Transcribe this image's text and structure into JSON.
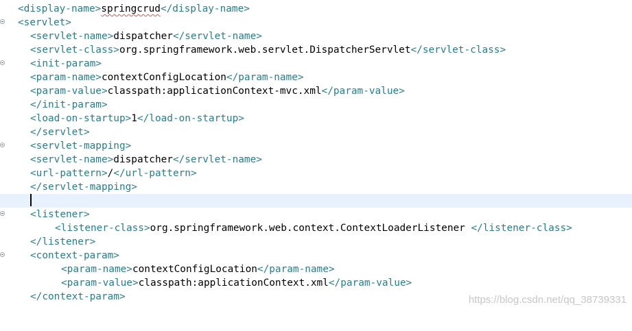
{
  "editor": {
    "lines": [
      {
        "open": "<display-name>",
        "text": "springcrud",
        "close": "</display-name>",
        "fold": false
      },
      {
        "open": "<servlet>",
        "text": "",
        "close": "",
        "fold": true
      },
      {
        "open": "<servlet-name>",
        "text": "dispatcher",
        "close": "</servlet-name>",
        "fold": false
      },
      {
        "open": "<servlet-class>",
        "text": "org.springframework.web.servlet.DispatcherServlet",
        "close": "</servlet-class>",
        "fold": false
      },
      {
        "open": "<init-param>",
        "text": "",
        "close": "",
        "fold": true
      },
      {
        "open": "<param-name>",
        "text": "contextConfigLocation",
        "close": "</param-name>",
        "fold": false
      },
      {
        "open": "<param-value>",
        "text": "classpath:applicationContext-mvc.xml",
        "close": "</param-value>",
        "fold": false
      },
      {
        "open": "</init-param>",
        "text": "",
        "close": "",
        "fold": false
      },
      {
        "open": "<load-on-startup>",
        "text": "1",
        "close": "</load-on-startup>",
        "fold": false
      },
      {
        "open": "</servlet>",
        "text": "",
        "close": "",
        "fold": false
      },
      {
        "open": "<servlet-mapping>",
        "text": "",
        "close": "",
        "fold": true
      },
      {
        "open": "<servlet-name>",
        "text": "dispatcher",
        "close": "</servlet-name>",
        "fold": false
      },
      {
        "open": "<url-pattern>",
        "text": "/",
        "close": "</url-pattern>",
        "fold": false
      },
      {
        "open": "</servlet-mapping>",
        "text": "",
        "close": "",
        "fold": false
      },
      {
        "open": "",
        "text": "",
        "close": "",
        "fold": false
      },
      {
        "open": "<listener>",
        "text": "",
        "close": "",
        "fold": true
      },
      {
        "open": "<listener-class>",
        "text": "org.springframework.web.context.ContextLoaderListener ",
        "close": "</listener-class>",
        "fold": false
      },
      {
        "open": "</listener>",
        "text": "",
        "close": "",
        "fold": false
      },
      {
        "open": "<context-param>",
        "text": "",
        "close": "",
        "fold": true
      },
      {
        "open": "<param-name>",
        "text": "contextConfigLocation",
        "close": "</param-name>",
        "fold": false
      },
      {
        "open": "<param-value>",
        "text": "classpath:applicationContext.xml",
        "close": "</param-value>",
        "fold": false
      },
      {
        "open": "</context-param>",
        "text": "",
        "close": "",
        "fold": false
      }
    ]
  },
  "watermark": "https://blog.csdn.net/qq_38739331",
  "colors": {
    "tag": "#267f8f",
    "text": "#000000",
    "current_line": "#e8f2fe"
  }
}
